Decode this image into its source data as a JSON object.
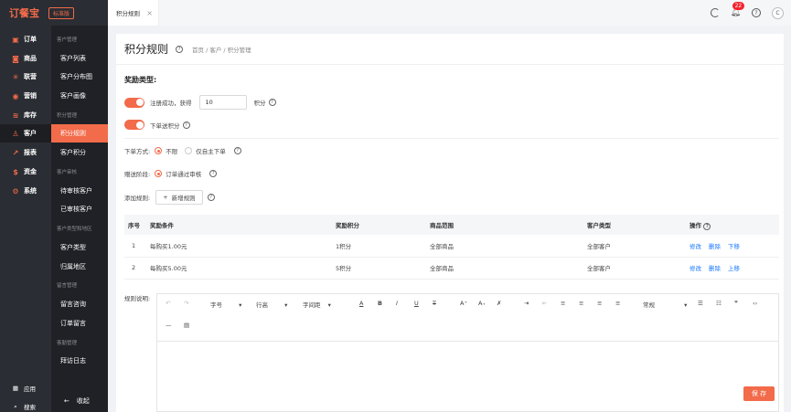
{
  "app": {
    "logo": "订餐宝",
    "edition": "标准版",
    "tab": "积分规则",
    "badge": "22",
    "avatar": "C"
  },
  "sidebar": {
    "items": [
      {
        "icon": "▣",
        "label": "订单"
      },
      {
        "icon": "◙",
        "label": "商品"
      },
      {
        "icon": "✳",
        "label": "联营"
      },
      {
        "icon": "◉",
        "label": "营销"
      },
      {
        "icon": "≋",
        "label": "库存"
      },
      {
        "icon": "♙",
        "label": "客户"
      },
      {
        "icon": "↗",
        "label": "报表"
      },
      {
        "icon": "$",
        "label": "资金"
      },
      {
        "icon": "⚙",
        "label": "系统"
      }
    ],
    "apps": "应用",
    "search": "搜索"
  },
  "subnav": {
    "groups": [
      "客户管理",
      "积分管理",
      "客户审核",
      "客户类型和地区",
      "留言管理",
      "客勤管理"
    ],
    "items": [
      "客户列表",
      "客户分布图",
      "客户画像",
      "积分规则",
      "客户积分",
      "待审核客户",
      "已审核客户",
      "客户类型",
      "归属地区",
      "留言咨询",
      "订单留言",
      "拜访日志"
    ],
    "collapse": "收起"
  },
  "page": {
    "title": "积分规则",
    "breadcrumb": "首页  /  客户  /  积分管理"
  },
  "form": {
    "section": "奖励类型:",
    "register_label": "注册成功，获得",
    "register_value": "10",
    "points_unit": "积分",
    "order_points": "下单送积分",
    "order_mode_label": "下单方式:",
    "order_mode_opt1": "不限",
    "order_mode_opt2": "仅自主下单",
    "gift_stage_label": "赠送阶段:",
    "gift_stage_opt1": "订单通过审核",
    "add_rule_label": "添加规则:",
    "add_rule_btn": "新增规则"
  },
  "table": {
    "headers": [
      "序号",
      "奖励条件",
      "奖励积分",
      "商品范围",
      "客户类型",
      "操作"
    ],
    "rows": [
      {
        "no": "1",
        "cond": "每购买1.00元",
        "points": "1积分",
        "scope": "全部商品",
        "ctype": "全部客户",
        "ops": [
          "修改",
          "删除",
          "下移"
        ]
      },
      {
        "no": "2",
        "cond": "每购买5.00元",
        "points": "5积分",
        "scope": "全部商品",
        "ctype": "全部客户",
        "ops": [
          "修改",
          "删除",
          "上移"
        ]
      }
    ]
  },
  "editor": {
    "label": "规则说明:",
    "font_size": "字号",
    "line_height": "行高",
    "letter_spacing": "字间距",
    "block": "常规"
  },
  "save": "保 存"
}
